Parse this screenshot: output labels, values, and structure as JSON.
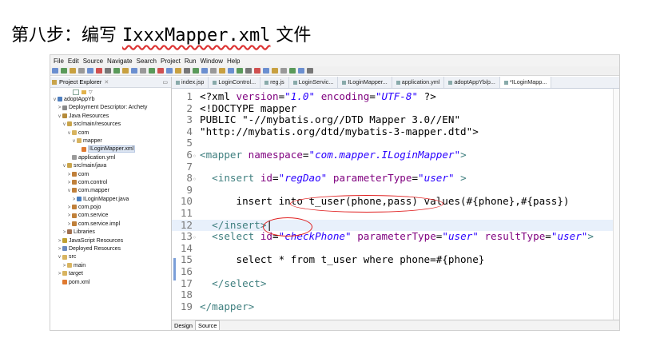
{
  "heading": {
    "prefix": "第八步：编写 ",
    "filename": "IxxxMapper.xml",
    "suffix": " 文件"
  },
  "menu": [
    "File",
    "Edit",
    "Source",
    "Navigate",
    "Search",
    "Project",
    "Run",
    "Window",
    "Help"
  ],
  "explorer": {
    "title": "Project Explorer",
    "items": [
      {
        "label": "adoptAppYb",
        "depth": 0,
        "toggle": "v",
        "icon": "project"
      },
      {
        "label": "Deployment Descriptor: Archety",
        "depth": 1,
        "toggle": ">",
        "icon": "descriptor"
      },
      {
        "label": "Java Resources",
        "depth": 1,
        "toggle": "v",
        "icon": "java-res"
      },
      {
        "label": "src/main/resources",
        "depth": 2,
        "toggle": "v",
        "icon": "src-folder"
      },
      {
        "label": "com",
        "depth": 3,
        "toggle": "v",
        "icon": "folder"
      },
      {
        "label": "mapper",
        "depth": 4,
        "toggle": "v",
        "icon": "folder"
      },
      {
        "label": "ILoginMapper.xml",
        "depth": 5,
        "toggle": "",
        "icon": "xml",
        "selected": true
      },
      {
        "label": "application.yml",
        "depth": 3,
        "toggle": "",
        "icon": "file"
      },
      {
        "label": "src/main/java",
        "depth": 2,
        "toggle": "v",
        "icon": "src-folder"
      },
      {
        "label": "com",
        "depth": 3,
        "toggle": ">",
        "icon": "package"
      },
      {
        "label": "com.control",
        "depth": 3,
        "toggle": ">",
        "icon": "package"
      },
      {
        "label": "com.mapper",
        "depth": 3,
        "toggle": "v",
        "icon": "package"
      },
      {
        "label": "ILoginMapper.java",
        "depth": 4,
        "toggle": ">",
        "icon": "java"
      },
      {
        "label": "com.pojo",
        "depth": 3,
        "toggle": ">",
        "icon": "package"
      },
      {
        "label": "com.service",
        "depth": 3,
        "toggle": ">",
        "icon": "package"
      },
      {
        "label": "com.service.impl",
        "depth": 3,
        "toggle": ">",
        "icon": "package"
      },
      {
        "label": "Libraries",
        "depth": 2,
        "toggle": ">",
        "icon": "library"
      },
      {
        "label": "JavaScript Resources",
        "depth": 1,
        "toggle": ">",
        "icon": "js"
      },
      {
        "label": "Deployed Resources",
        "depth": 1,
        "toggle": ">",
        "icon": "deployed"
      },
      {
        "label": "src",
        "depth": 1,
        "toggle": "v",
        "icon": "folder"
      },
      {
        "label": "main",
        "depth": 2,
        "toggle": ">",
        "icon": "folder"
      },
      {
        "label": "target",
        "depth": 1,
        "toggle": ">",
        "icon": "folder"
      },
      {
        "label": "pom.xml",
        "depth": 1,
        "toggle": "",
        "icon": "xml"
      }
    ]
  },
  "tabs": [
    {
      "label": "index.jsp",
      "active": false
    },
    {
      "label": "LoginControl...",
      "active": false
    },
    {
      "label": "reg.js",
      "active": false
    },
    {
      "label": "LoginServic...",
      "active": false
    },
    {
      "label": "ILoginMapper...",
      "active": false
    },
    {
      "label": "application.yml",
      "active": false
    },
    {
      "label": "adoptAppYb/p...",
      "active": false
    },
    {
      "label": "*ILoginMapp...",
      "active": true
    }
  ],
  "editor": {
    "lines": [
      {
        "n": "1",
        "segs": [
          [
            "plain",
            "<?xml "
          ],
          [
            "attr",
            "version"
          ],
          [
            "plain",
            "="
          ],
          [
            "str",
            "\"1.0\""
          ],
          [
            "plain",
            " "
          ],
          [
            "attr",
            "encoding"
          ],
          [
            "plain",
            "="
          ],
          [
            "str",
            "\"UTF-8\""
          ],
          [
            "plain",
            " ?>"
          ]
        ]
      },
      {
        "n": "2",
        "segs": [
          [
            "plain",
            "<!DOCTYPE mapper"
          ]
        ]
      },
      {
        "n": "3",
        "segs": [
          [
            "plain",
            "PUBLIC \"-//mybatis.org//DTD Mapper 3.0//EN\""
          ]
        ]
      },
      {
        "n": "4",
        "segs": [
          [
            "plain",
            "\"http://mybatis.org/dtd/mybatis-3-mapper.dtd\">"
          ]
        ]
      },
      {
        "n": "5",
        "segs": []
      },
      {
        "n": "6",
        "fold": true,
        "segs": [
          [
            "tag",
            "<mapper "
          ],
          [
            "attr",
            "namespace"
          ],
          [
            "plain",
            "="
          ],
          [
            "str",
            "\"com.mapper.ILoginMapper\""
          ],
          [
            "tag",
            ">"
          ]
        ]
      },
      {
        "n": "7",
        "segs": []
      },
      {
        "n": "8",
        "fold": true,
        "segs": [
          [
            "plain",
            "  "
          ],
          [
            "tag",
            "<insert "
          ],
          [
            "attr",
            "id"
          ],
          [
            "plain",
            "="
          ],
          [
            "str",
            "\"regDao\""
          ],
          [
            "plain",
            " "
          ],
          [
            "attr",
            "parameterType"
          ],
          [
            "plain",
            "="
          ],
          [
            "str",
            "\"user\""
          ],
          [
            "tag",
            " >"
          ]
        ]
      },
      {
        "n": "9",
        "segs": []
      },
      {
        "n": "10",
        "segs": [
          [
            "plain",
            "      insert into t_user(phone,pass) values(#{phone},#{pass})"
          ]
        ]
      },
      {
        "n": "11",
        "segs": []
      },
      {
        "n": "12",
        "highlight": true,
        "segs": [
          [
            "plain",
            "  "
          ],
          [
            "tag",
            "</insert>"
          ],
          [
            "plain",
            "|"
          ]
        ]
      },
      {
        "n": "13",
        "fold": true,
        "segs": [
          [
            "plain",
            "  "
          ],
          [
            "tag",
            "<select "
          ],
          [
            "attr",
            "id"
          ],
          [
            "plain",
            "="
          ],
          [
            "str",
            "\"checkPhone\""
          ],
          [
            "plain",
            " "
          ],
          [
            "attr",
            "parameterType"
          ],
          [
            "plain",
            "="
          ],
          [
            "str",
            "\"user\""
          ],
          [
            "plain",
            " "
          ],
          [
            "attr",
            "resultType"
          ],
          [
            "plain",
            "="
          ],
          [
            "str",
            "\"user\""
          ],
          [
            "tag",
            ">"
          ]
        ]
      },
      {
        "n": "14",
        "segs": []
      },
      {
        "n": "15",
        "segs": [
          [
            "plain",
            "      select * from t_user where phone=#{phone}"
          ]
        ]
      },
      {
        "n": "16",
        "segs": []
      },
      {
        "n": "17",
        "segs": [
          [
            "plain",
            "  "
          ],
          [
            "tag",
            "</select>"
          ]
        ]
      },
      {
        "n": "18",
        "segs": []
      },
      {
        "n": "19",
        "segs": [
          [
            "tag",
            "</mapper>"
          ]
        ]
      }
    ]
  },
  "bottom_tabs": [
    {
      "label": "Design",
      "active": false
    },
    {
      "label": "Source",
      "active": true
    }
  ],
  "colors": {
    "tag": "#3f7f7f",
    "attr": "#7f007f",
    "str": "#2a00ff",
    "annotation": "#e02020"
  }
}
